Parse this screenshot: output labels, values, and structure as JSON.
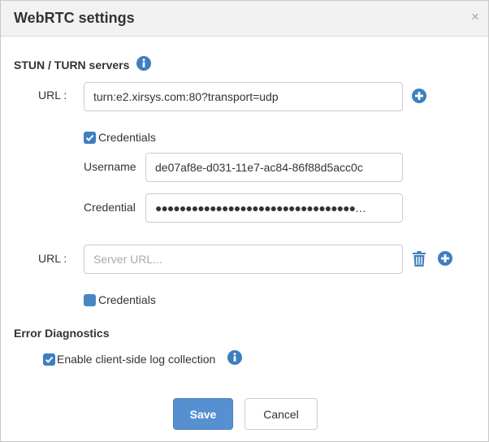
{
  "dialog": {
    "title": "WebRTC settings",
    "close_glyph": "×"
  },
  "stun_section": {
    "title": "STUN / TURN servers",
    "servers": [
      {
        "url_label": "URL :",
        "url_value": "turn:e2.xirsys.com:80?transport=udp",
        "credentials_label": "Credentials",
        "credentials_checked": true,
        "username_label": "Username",
        "username_value": "de07af8e-d031-11e7-ac84-86f88d5acc0c",
        "credential_label": "Credential",
        "credential_value": "●●●●●●●●●●●●●●●●●●●●●●●●●●●●●●●●●…"
      },
      {
        "url_label": "URL :",
        "url_value": "",
        "url_placeholder": "Server URL...",
        "credentials_label": "Credentials",
        "credentials_checked": false
      }
    ]
  },
  "error_section": {
    "title": "Error Diagnostics",
    "log_label": "Enable client-side log collection",
    "log_checked": true
  },
  "buttons": {
    "save": "Save",
    "cancel": "Cancel"
  },
  "colors": {
    "accent": "#3f7ec0",
    "primary_button": "#5790d0",
    "header_bg": "#f2f2f2"
  },
  "icons": {
    "info": "info-circle-icon",
    "add": "plus-circle-icon",
    "delete": "trash-icon",
    "check": "check-icon",
    "close": "close-icon"
  }
}
